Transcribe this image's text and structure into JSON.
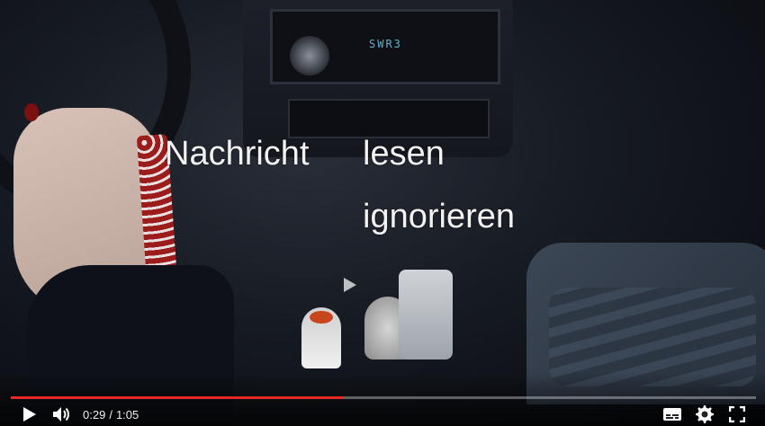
{
  "video": {
    "overlay": {
      "option_a": "Nachricht",
      "option_b": "lesen",
      "option_c": "ignorieren"
    },
    "radio_display": "SWR3"
  },
  "controls": {
    "current_time": "0:29",
    "separator": "/",
    "duration": "1:05",
    "progress_fraction": 0.446,
    "icons": {
      "play": "play-icon",
      "volume": "volume-icon",
      "subtitles": "subtitles-icon",
      "settings": "gear-icon",
      "fullscreen": "fullscreen-icon"
    },
    "accent_color": "#e52a22"
  }
}
